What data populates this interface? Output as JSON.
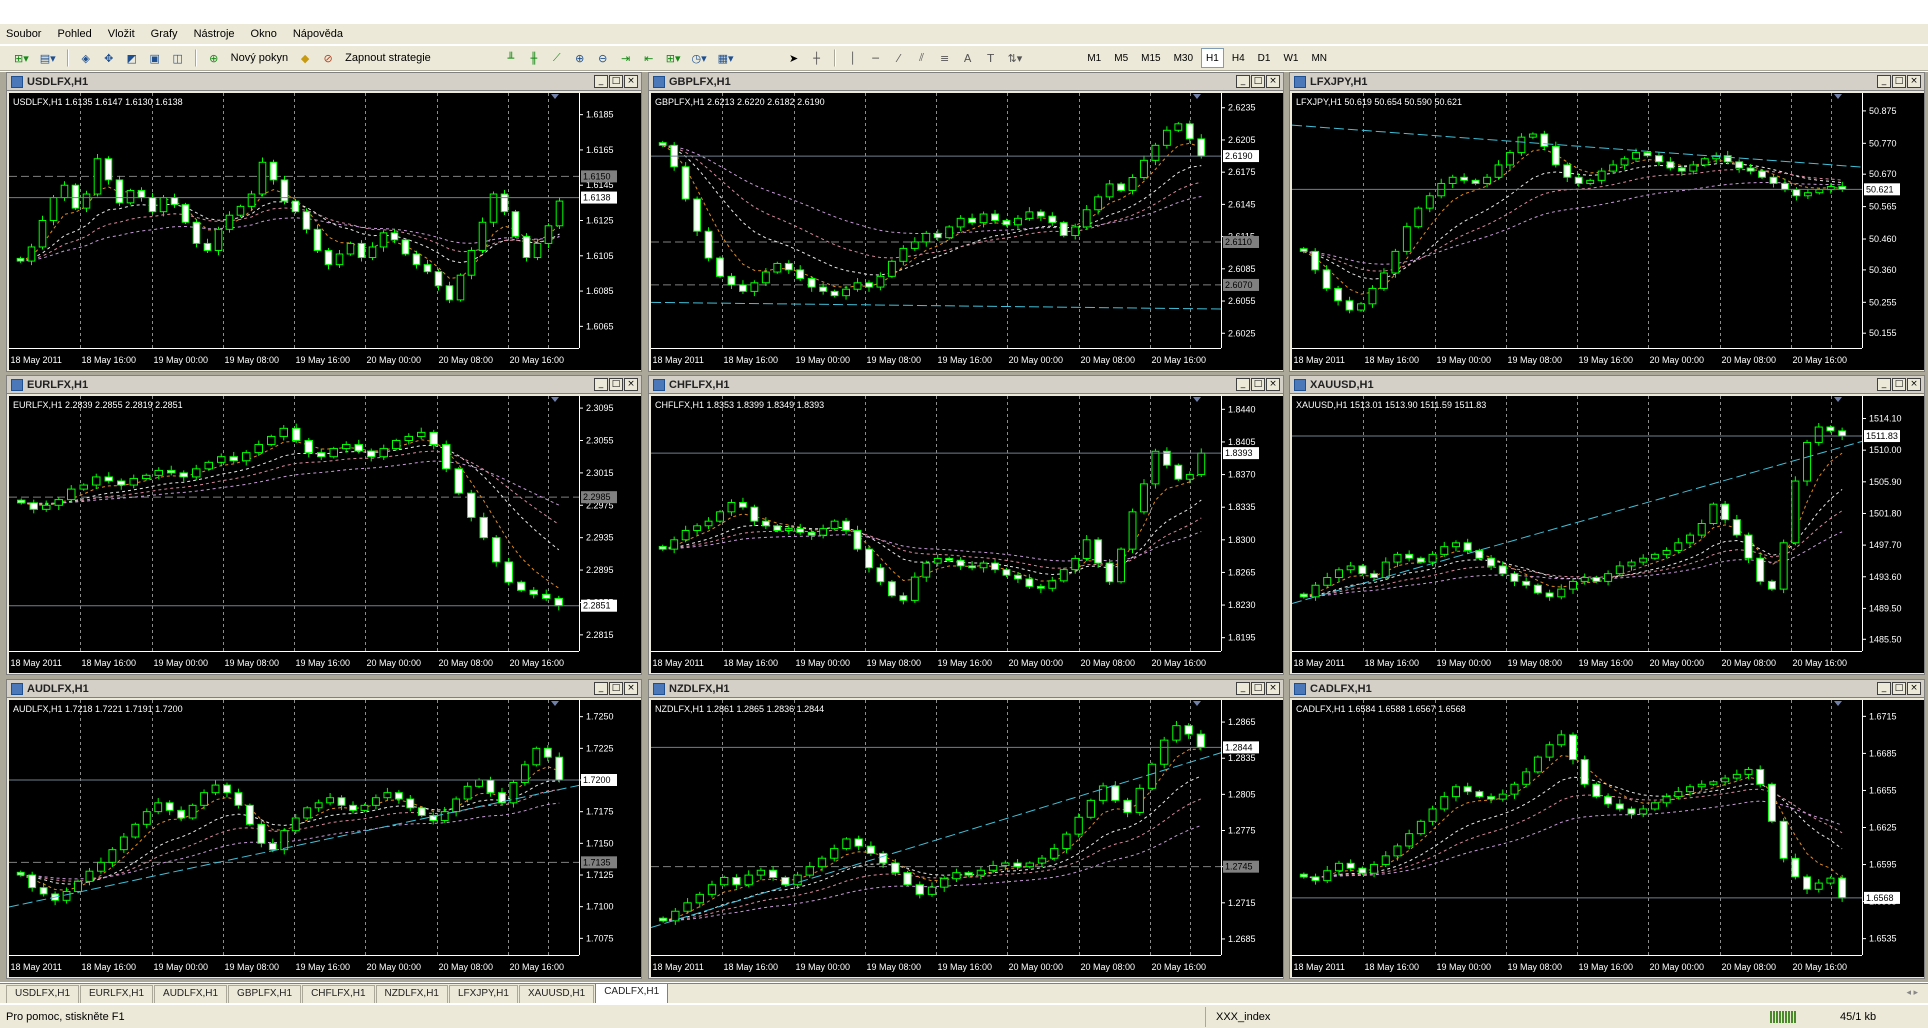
{
  "menu": [
    "Soubor",
    "Pohled",
    "Vložit",
    "Grafy",
    "Nástroje",
    "Okno",
    "Nápověda"
  ],
  "toolbar": {
    "new_order": "Nový pokyn",
    "autotrading": "Zapnout strategie",
    "timeframes": [
      "M1",
      "M5",
      "M15",
      "M30",
      "H1",
      "H4",
      "D1",
      "W1",
      "MN"
    ],
    "active_timeframe": "H1",
    "drawing": [
      "cursor",
      "crosshair",
      "vertical-line",
      "horizontal-line",
      "trend-line",
      "equidistant-channel",
      "fibonacci",
      "text",
      "label",
      "arrows"
    ]
  },
  "colors": {
    "chart_bg": "#000000",
    "bull": "#00ff00",
    "bear": "#ffffff",
    "grid": "#ffffff",
    "axis_text": "#ffffff",
    "current_price_line": "#708090",
    "trend_cyan": "#40c0d8",
    "ma_orange": "#e08a20",
    "ma_pink": "#d88aa0",
    "ma_white": "#e8e8e8"
  },
  "time_labels": [
    "18 May 2011",
    "18 May 16:00",
    "19 May 00:00",
    "19 May 08:00",
    "19 May 16:00",
    "20 May 00:00",
    "20 May 08:00",
    "20 May 16:00"
  ],
  "charts": [
    {
      "title": "USDLFX,H1",
      "info": "USDLFX,H1  1.6135 1.6147 1.6130 1.6138",
      "last": "1.6138",
      "ylabels": [
        "1.6185",
        "1.6165",
        "1.6145",
        "1.6125",
        "1.6105",
        "1.6085",
        "1.6065"
      ],
      "marks": [
        "1.6150"
      ],
      "ylim": [
        1.6055,
        1.6195
      ],
      "closes": [
        1.6102,
        1.611,
        1.6125,
        1.6138,
        1.6145,
        1.6132,
        1.614,
        1.616,
        1.6148,
        1.6135,
        1.6142,
        1.6138,
        1.613,
        1.6138,
        1.6134,
        1.6124,
        1.6112,
        1.6108,
        1.612,
        1.6128,
        1.6133,
        1.614,
        1.6158,
        1.6148,
        1.6136,
        1.613,
        1.612,
        1.6108,
        1.61,
        1.6106,
        1.6112,
        1.6104,
        1.611,
        1.6118,
        1.6114,
        1.6106,
        1.61,
        1.6096,
        1.6088,
        1.608,
        1.6094,
        1.6108,
        1.6124,
        1.614,
        1.613,
        1.6116,
        1.6104,
        1.6112,
        1.6122,
        1.6136
      ]
    },
    {
      "title": "GBPLFX,H1",
      "info": "GBPLFX,H1  2.6213 2.6220 2.6182 2.6190",
      "last": "2.6190",
      "ylabels": [
        "2.6235",
        "2.6205",
        "2.6175",
        "2.6145",
        "2.6115",
        "2.6085",
        "2.6055",
        "2.6025"
      ],
      "marks": [
        "2.6110",
        "2.6070"
      ],
      "ylim": [
        2.6015,
        2.6245
      ],
      "closes": [
        2.62,
        2.618,
        2.615,
        2.612,
        2.6095,
        2.6078,
        2.607,
        2.6064,
        2.6072,
        2.6082,
        2.609,
        2.6084,
        2.6076,
        2.6068,
        2.6064,
        2.606,
        2.6066,
        2.6072,
        2.6068,
        2.6078,
        2.6092,
        2.6104,
        2.611,
        2.6118,
        2.6114,
        2.6124,
        2.6132,
        2.6128,
        2.6136,
        2.613,
        2.6126,
        2.6132,
        2.6138,
        2.6134,
        2.6128,
        2.6116,
        2.6124,
        2.614,
        2.6152,
        2.6164,
        2.6158,
        2.617,
        2.6186,
        2.62,
        2.6214,
        2.622,
        2.6206,
        2.619
      ]
    },
    {
      "title": "LFXJPY,H1",
      "info": "LFXJPY,H1  50.619 50.654 50.590 50.621",
      "last": "50.621",
      "ylabels": [
        "50.875",
        "50.770",
        "50.670",
        "50.565",
        "50.460",
        "50.360",
        "50.255",
        "50.155"
      ],
      "marks": [],
      "ylim": [
        50.12,
        50.92
      ],
      "closes": [
        50.42,
        50.36,
        50.3,
        50.26,
        50.23,
        50.25,
        50.3,
        50.35,
        50.42,
        50.5,
        50.56,
        50.6,
        50.64,
        50.66,
        50.65,
        50.64,
        50.66,
        50.7,
        50.74,
        50.79,
        50.8,
        50.76,
        50.7,
        50.66,
        50.64,
        50.65,
        50.68,
        50.7,
        50.72,
        50.74,
        50.73,
        50.71,
        50.69,
        50.68,
        50.7,
        50.72,
        50.73,
        50.71,
        50.69,
        50.68,
        50.66,
        50.64,
        50.62,
        50.6,
        50.61,
        50.62,
        50.63,
        50.621
      ]
    },
    {
      "title": "EURLFX,H1",
      "info": "EURLFX,H1  2.2839 2.2855 2.2819 2.2851",
      "last": "2.2851",
      "ylabels": [
        "2.3095",
        "2.3055",
        "2.3015",
        "2.2975",
        "2.2935",
        "2.2895",
        "2.2855",
        "2.2815"
      ],
      "marks": [
        "2.2985"
      ],
      "ylim": [
        2.28,
        2.3105
      ],
      "closes": [
        2.2978,
        2.297,
        2.2975,
        2.2982,
        2.2995,
        2.3,
        2.301,
        2.3005,
        2.3,
        2.3008,
        2.3012,
        2.3018,
        2.3015,
        2.301,
        2.302,
        2.3028,
        2.3035,
        2.303,
        2.304,
        2.305,
        2.306,
        2.307,
        2.3055,
        2.304,
        2.3035,
        2.3045,
        2.305,
        2.3042,
        2.3035,
        2.3045,
        2.3055,
        2.306,
        2.3065,
        2.305,
        2.302,
        2.299,
        2.296,
        2.2935,
        2.2905,
        2.288,
        2.287,
        2.2865,
        2.286,
        2.2851
      ]
    },
    {
      "title": "CHFLFX,H1",
      "info": "CHFLFX,H1  1.8353 1.8399 1.8349 1.8393",
      "last": "1.8393",
      "ylabels": [
        "1.8440",
        "1.8405",
        "1.8370",
        "1.8335",
        "1.8300",
        "1.8265",
        "1.8230",
        "1.8195"
      ],
      "marks": [],
      "ylim": [
        1.8185,
        1.845
      ],
      "closes": [
        1.829,
        1.83,
        1.831,
        1.8315,
        1.832,
        1.833,
        1.834,
        1.8335,
        1.832,
        1.8315,
        1.831,
        1.8312,
        1.8308,
        1.8305,
        1.8312,
        1.832,
        1.831,
        1.829,
        1.827,
        1.8255,
        1.824,
        1.8235,
        1.826,
        1.8275,
        1.828,
        1.8278,
        1.8272,
        1.827,
        1.8275,
        1.8268,
        1.8262,
        1.8258,
        1.825,
        1.8248,
        1.8256,
        1.8268,
        1.828,
        1.83,
        1.8275,
        1.8255,
        1.829,
        1.833,
        1.836,
        1.8395,
        1.838,
        1.8365,
        1.837,
        1.8393
      ]
    },
    {
      "title": "XAUUSD,H1",
      "info": "XAUUSD,H1  1513.01 1513.90 1511.59 1511.83",
      "last": "1511.83",
      "ylabels": [
        "1514.10",
        "1510.00",
        "1505.90",
        "1501.80",
        "1497.70",
        "1493.60",
        "1489.50",
        "1485.50"
      ],
      "marks": [],
      "ylim": [
        1484.5,
        1516.5
      ],
      "closes": [
        1491.0,
        1492.5,
        1493.5,
        1494.5,
        1495.0,
        1494.0,
        1493.5,
        1495.5,
        1496.5,
        1496.0,
        1495.5,
        1496.5,
        1497.5,
        1498.0,
        1497.0,
        1496.0,
        1495.0,
        1494.0,
        1493.0,
        1492.5,
        1491.5,
        1491.0,
        1492.0,
        1493.0,
        1493.5,
        1493.0,
        1494.0,
        1495.0,
        1495.5,
        1496.0,
        1496.5,
        1497.0,
        1498.0,
        1499.0,
        1500.5,
        1503.0,
        1501.0,
        1499.0,
        1496.0,
        1493.0,
        1492.0,
        1498.0,
        1506.0,
        1511.0,
        1513.0,
        1512.5,
        1511.83
      ]
    },
    {
      "title": "AUDLFX,H1",
      "info": "AUDLFX,H1  1.7218 1.7221 1.7191 1.7200",
      "last": "1.7200",
      "ylabels": [
        "1.7250",
        "1.7225",
        "1.7200",
        "1.7175",
        "1.7150",
        "1.7125",
        "1.7100",
        "1.7075"
      ],
      "marks": [
        "1.7135"
      ],
      "ylim": [
        1.7065,
        1.726
      ],
      "closes": [
        1.7125,
        1.7115,
        1.711,
        1.7105,
        1.7112,
        1.712,
        1.7128,
        1.7135,
        1.7145,
        1.7155,
        1.7165,
        1.7175,
        1.7182,
        1.7176,
        1.717,
        1.718,
        1.719,
        1.7196,
        1.719,
        1.718,
        1.7165,
        1.715,
        1.7145,
        1.716,
        1.717,
        1.7178,
        1.7182,
        1.7186,
        1.718,
        1.7176,
        1.718,
        1.7186,
        1.719,
        1.7185,
        1.7178,
        1.7172,
        1.7168,
        1.7175,
        1.7185,
        1.7195,
        1.72,
        1.719,
        1.7182,
        1.7198,
        1.7212,
        1.7225,
        1.7218,
        1.72
      ]
    },
    {
      "title": "NZDLFX,H1",
      "info": "NZDLFX,H1  1.2861 1.2865 1.2836 1.2844",
      "last": "1.2844",
      "ylabels": [
        "1.2865",
        "1.2835",
        "1.2805",
        "1.2775",
        "1.2745",
        "1.2715",
        "1.2685"
      ],
      "marks": [
        "1.2745"
      ],
      "ylim": [
        1.2675,
        1.288
      ],
      "closes": [
        1.27,
        1.2708,
        1.2715,
        1.2722,
        1.273,
        1.2736,
        1.273,
        1.2738,
        1.2742,
        1.2736,
        1.273,
        1.2738,
        1.2745,
        1.2752,
        1.276,
        1.2768,
        1.2762,
        1.2756,
        1.2748,
        1.274,
        1.273,
        1.2722,
        1.2728,
        1.2735,
        1.274,
        1.2738,
        1.2742,
        1.2746,
        1.2748,
        1.2745,
        1.2748,
        1.2752,
        1.276,
        1.2772,
        1.2786,
        1.28,
        1.2812,
        1.28,
        1.279,
        1.281,
        1.283,
        1.285,
        1.2862,
        1.2855,
        1.2844
      ]
    },
    {
      "title": "CADLFX,H1",
      "info": "CADLFX,H1  1.6584 1.6588 1.6567 1.6568",
      "last": "1.6568",
      "ylabels": [
        "1.6715",
        "1.6685",
        "1.6655",
        "1.6625",
        "1.6595",
        "1.6565",
        "1.6535"
      ],
      "marks": [],
      "ylim": [
        1.6525,
        1.6725
      ],
      "closes": [
        1.6585,
        1.6582,
        1.659,
        1.6596,
        1.6592,
        1.6588,
        1.6595,
        1.6602,
        1.661,
        1.662,
        1.663,
        1.664,
        1.665,
        1.6658,
        1.6654,
        1.665,
        1.6648,
        1.6652,
        1.666,
        1.667,
        1.6682,
        1.6692,
        1.67,
        1.668,
        1.666,
        1.665,
        1.6644,
        1.664,
        1.6636,
        1.664,
        1.6645,
        1.665,
        1.6654,
        1.6658,
        1.666,
        1.6662,
        1.6665,
        1.6668,
        1.6672,
        1.666,
        1.663,
        1.66,
        1.6585,
        1.6575,
        1.658,
        1.6584,
        1.6568
      ]
    }
  ],
  "tabs": [
    "USDLFX,H1",
    "EURLFX,H1",
    "AUDLFX,H1",
    "GBPLFX,H1",
    "CHFLFX,H1",
    "NZDLFX,H1",
    "LFXJPY,H1",
    "XAUUSD,H1",
    "CADLFX,H1"
  ],
  "active_tab": "CADLFX,H1",
  "status": {
    "help": "Pro pomoc, stiskněte F1",
    "profile": "XXX_index",
    "traffic": "45/1 kb"
  }
}
